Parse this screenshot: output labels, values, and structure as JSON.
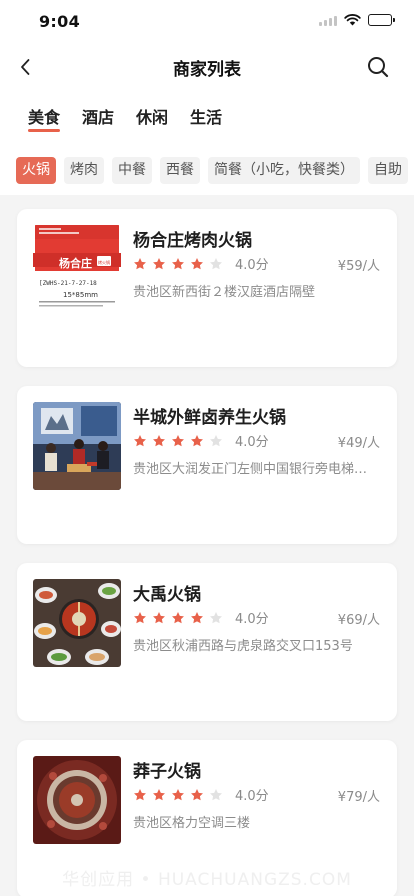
{
  "status": {
    "time": "9:04"
  },
  "nav": {
    "title": "商家列表",
    "back_icon": "chevron-left-icon",
    "search_icon": "search-icon"
  },
  "main_tabs": [
    {
      "label": "美食",
      "active": true
    },
    {
      "label": "酒店",
      "active": false
    },
    {
      "label": "休闲",
      "active": false
    },
    {
      "label": "生活",
      "active": false
    }
  ],
  "sub_tabs": [
    {
      "label": "火锅",
      "active": true
    },
    {
      "label": "烤肉",
      "active": false
    },
    {
      "label": "中餐",
      "active": false
    },
    {
      "label": "西餐",
      "active": false
    },
    {
      "label": "简餐（小吃，快餐类）",
      "active": false
    },
    {
      "label": "自助",
      "active": false
    }
  ],
  "merchants": [
    {
      "name": "杨合庄烤肉火锅",
      "rating_stars": 4,
      "score": "4.0分",
      "price": "¥59/人",
      "address": "贵池区新西街２楼汉庭酒店隔壁",
      "image": {
        "kind": "label",
        "line1": "杨合庄",
        "line2": "烤火锅",
        "code": "[ZWHS-21-7-27-18",
        "size": "15*85mm"
      }
    },
    {
      "name": "半城外鲜卤养生火锅",
      "rating_stars": 4,
      "score": "4.0分",
      "price": "¥49/人",
      "address": "贵池区大润发正门左侧中国银行旁电梯上三楼",
      "image": {
        "kind": "tv-studio"
      }
    },
    {
      "name": "大禹火锅",
      "rating_stars": 4,
      "score": "4.0分",
      "price": "¥69/人",
      "address": "贵池区秋浦西路与虎泉路交叉口153号",
      "image": {
        "kind": "hotpot-table"
      }
    },
    {
      "name": "莽子火锅",
      "rating_stars": 4,
      "score": "4.0分",
      "price": "¥79/人",
      "address": "贵池区格力空调三楼",
      "image": {
        "kind": "hotpot-pot"
      }
    }
  ],
  "watermark": "华创应用 • HUACHUANGZS.COM",
  "colors": {
    "accent": "#e8614a",
    "star_on": "#e8614a",
    "star_off": "#e2e2e2",
    "list_bg": "#f4f4f4"
  }
}
